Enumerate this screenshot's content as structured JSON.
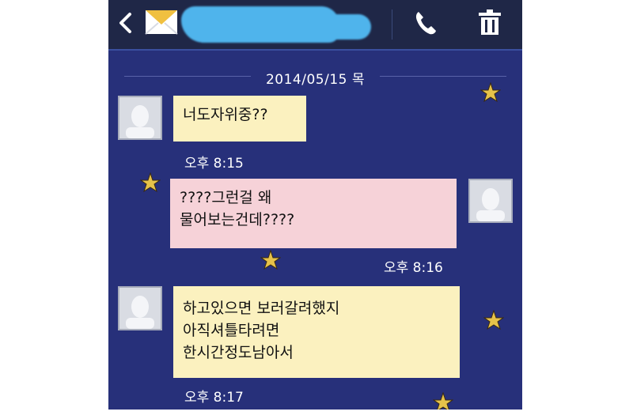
{
  "header": {
    "back_icon": "chevron-left-icon",
    "contact_icon": "envelope-icon",
    "call_icon": "phone-icon",
    "delete_icon": "trash-icon"
  },
  "date_divider": "2014/05/15 목",
  "messages": [
    {
      "direction": "incoming",
      "text": "너도자위중??",
      "time": "오후 8:15"
    },
    {
      "direction": "outgoing",
      "text": "????그런걸 왜\n물어보는건데????",
      "time": "오후 8:16"
    },
    {
      "direction": "incoming",
      "text": "하고있으면 보러갈려했지\n아직셔틀타려면\n한시간정도남아서",
      "time": "오후 8:17"
    }
  ],
  "colors": {
    "background": "#27307a",
    "header": "#1f2747",
    "incoming_bubble": "#fbf1bf",
    "outgoing_bubble": "#f6d2d8",
    "contact_name_redaction": "#4fb4ec"
  }
}
